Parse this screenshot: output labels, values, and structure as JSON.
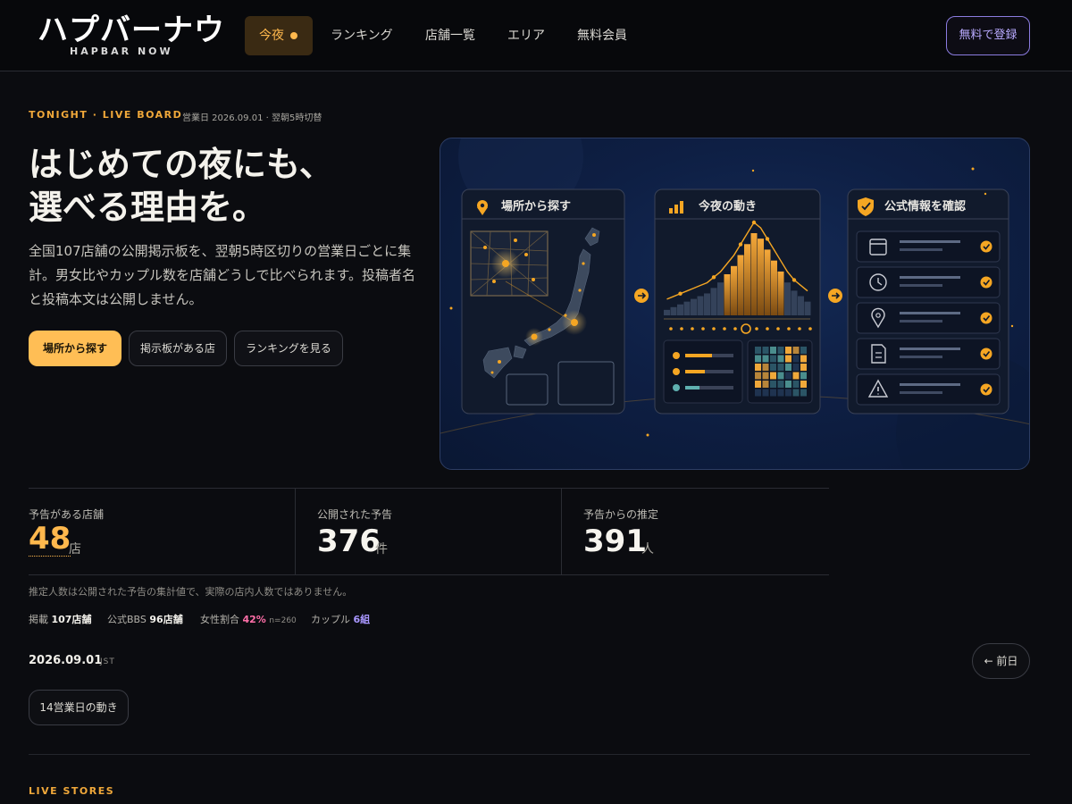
{
  "header": {
    "logo_main": "ハプバーナウ",
    "logo_sub": "HAPBAR NOW",
    "nav": [
      {
        "label": "今夜"
      },
      {
        "label": "ランキング"
      },
      {
        "label": "店舗一覧"
      },
      {
        "label": "エリア"
      },
      {
        "label": "無料会員"
      }
    ],
    "register_label": "無料で登録"
  },
  "hero": {
    "eyebrow": "TONIGHT · LIVE BOARD",
    "eyebrow_meta": "営業日 2026.09.01 · 翌朝5時切替",
    "headline_line1": "はじめての夜にも、",
    "headline_line2": "選べる理由を。",
    "lead": "全国107店舗の公開掲示板を、翌朝5時区切りの営業日ごとに集計。男女比やカップル数を店舗どうしで比べられます。投稿者名と投稿本文は公開しません。",
    "cta_primary": "場所から探す",
    "cta_secondary": "掲示板がある店",
    "cta_tertiary": "ランキングを見る"
  },
  "illustration": {
    "panel1_title": "場所から探す",
    "panel2_title": "今夜の動き",
    "panel3_title": "公式情報を確認",
    "histogram": [
      2,
      3,
      4,
      5,
      6,
      7,
      8,
      10,
      12,
      15,
      18,
      22,
      26,
      30,
      28,
      24,
      20,
      16,
      12,
      9,
      7,
      5
    ],
    "accent": "#f5a623",
    "checklist_icons": [
      "calendar-icon",
      "clock-icon",
      "pin-icon",
      "document-icon",
      "warning-icon"
    ]
  },
  "stats": [
    {
      "label": "予告がある店舗",
      "value": "48",
      "unit": "店"
    },
    {
      "label": "公開された予告",
      "value": "376",
      "unit": "件"
    },
    {
      "label": "予告からの推定",
      "value": "391",
      "unit": "人"
    }
  ],
  "note": "推定人数は公開された予告の集計値で、実際の店内人数ではありません。",
  "meta": {
    "listed_label": "掲載",
    "listed_value": "107店舗",
    "bbs_label": "公式BBS",
    "bbs_value": "96店舗",
    "female_label": "女性割合",
    "female_value": "42%",
    "female_n": "n=260",
    "couple_label": "カップル",
    "couple_value": "6組"
  },
  "date_bar": {
    "date": "2026.09.01",
    "tz": "JST",
    "prev_label": "← 前日",
    "trend_label": "14営業日の動き"
  },
  "live_stores_title": "LIVE STORES"
}
